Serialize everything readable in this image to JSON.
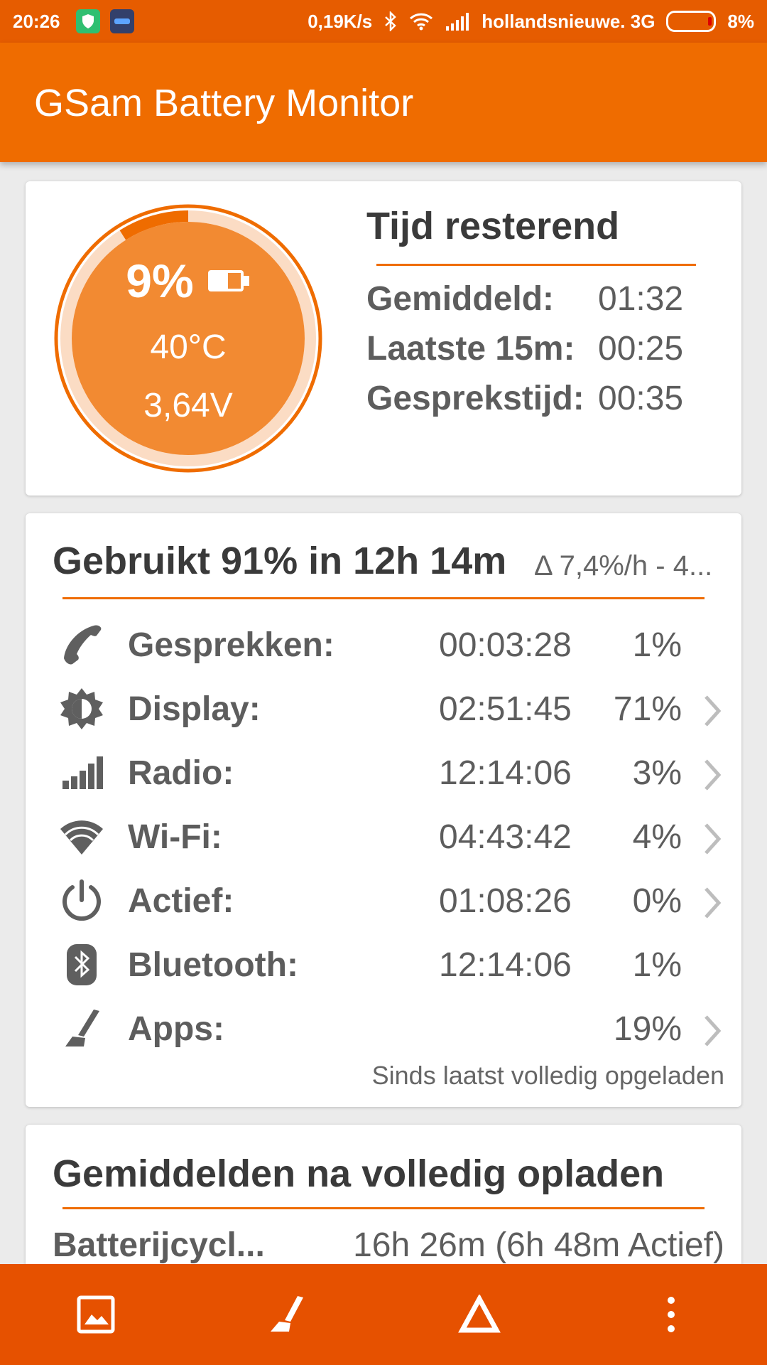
{
  "status_bar": {
    "time": "20:26",
    "net_speed": "0,19K/s",
    "carrier": "hollandsnieuwe. 3G",
    "battery_pct": "8%",
    "icons": [
      "shield-icon",
      "app-icon",
      "bluetooth-icon",
      "wifi-icon",
      "signal-icon",
      "battery-icon"
    ]
  },
  "app_bar": {
    "title": "GSam Battery Monitor"
  },
  "battery_card": {
    "percent": "9%",
    "level": 0.09,
    "temperature": "40°C",
    "voltage": "3,64V",
    "time_remaining": {
      "title": "Tijd resterend",
      "rows": [
        {
          "label": "Gemiddeld:",
          "value": "01:32"
        },
        {
          "label": "Laatste 15m:",
          "value": "00:25"
        },
        {
          "label": "Gesprekstijd:",
          "value": "00:35"
        }
      ]
    },
    "colors": {
      "accent": "#ef6c00",
      "gauge_fill": "#f28a32",
      "gauge_track": "#fbdcc4"
    }
  },
  "usage_card": {
    "title": "Gebruikt 91% in 12h 14m",
    "subtitle": "Δ 7,4%/h - 4...",
    "rows": [
      {
        "icon": "phone-icon",
        "label": "Gesprekken:",
        "time": "00:03:28",
        "pct": "1%",
        "chevron": false
      },
      {
        "icon": "brightness-icon",
        "label": "Display:",
        "time": "02:51:45",
        "pct": "71%",
        "chevron": true
      },
      {
        "icon": "signal-bars-icon",
        "label": "Radio:",
        "time": "12:14:06",
        "pct": "3%",
        "chevron": true
      },
      {
        "icon": "wifi-icon",
        "label": "Wi-Fi:",
        "time": "04:43:42",
        "pct": "4%",
        "chevron": true
      },
      {
        "icon": "power-icon",
        "label": "Actief:",
        "time": "01:08:26",
        "pct": "0%",
        "chevron": true
      },
      {
        "icon": "bluetooth-icon",
        "label": "Bluetooth:",
        "time": "12:14:06",
        "pct": "1%",
        "chevron": false
      },
      {
        "icon": "apps-icon",
        "label": "Apps:",
        "time": "",
        "pct": "19%",
        "chevron": true
      }
    ],
    "footer": "Sinds laatst volledig opgeladen"
  },
  "averages_card": {
    "title": "Gemiddelden na volledig opladen",
    "row_label": "Batterijcycl...",
    "row_value": "16h 26m (6h 48m Actief)"
  },
  "bottom_bar": {
    "buttons": [
      "image-icon",
      "apps-icon",
      "delta-icon",
      "more-vert-icon"
    ]
  }
}
